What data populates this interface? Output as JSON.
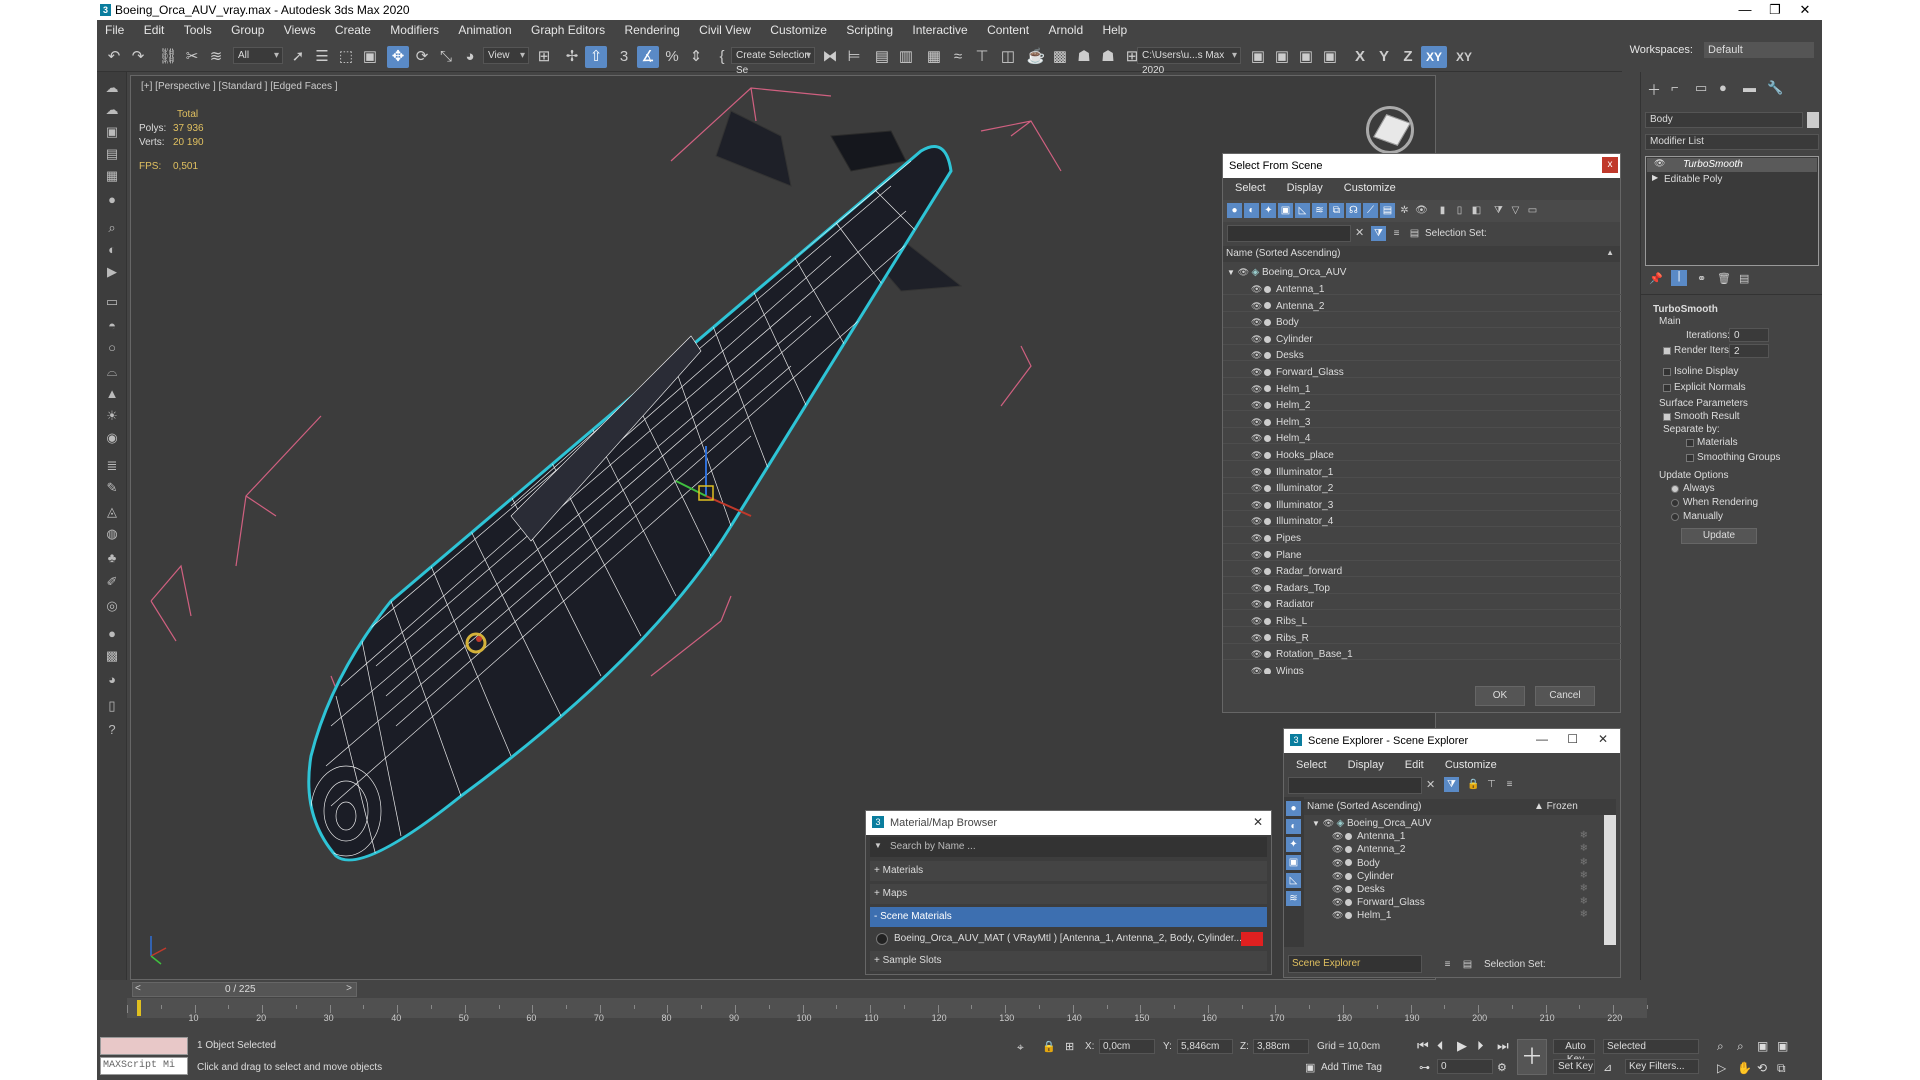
{
  "window": {
    "title": "Boeing_Orca_AUV_vray.max - Autodesk 3ds Max 2020",
    "minimize": "—",
    "maximize": "❐",
    "close": "✕"
  },
  "menu": [
    "File",
    "Edit",
    "Tools",
    "Group",
    "Views",
    "Create",
    "Modifiers",
    "Animation",
    "Graph Editors",
    "Rendering",
    "Civil View",
    "Customize",
    "Scripting",
    "Interactive",
    "Content",
    "Arnold",
    "Help"
  ],
  "workspace": {
    "label": "Workspaces:",
    "value": "Default"
  },
  "toolbar": {
    "filter": "All",
    "view": "View",
    "selection_set": "Create Selection Se",
    "path": "C:\\Users\\u...s Max 2020",
    "axes": [
      "X",
      "Y",
      "Z",
      "XY",
      "XY"
    ]
  },
  "viewport": {
    "label": "[+] [Perspective ] [Standard ] [Edged Faces ]",
    "stats": {
      "total_label": "Total",
      "polys_label": "Polys:",
      "polys": "37 936",
      "verts_label": "Verts:",
      "verts": "20 190",
      "fps_label": "FPS:",
      "fps": "0,501"
    }
  },
  "command_panel": {
    "object_name": "Body",
    "modifier_list": "Modifier List",
    "stack": [
      "TurboSmooth",
      "Editable Poly"
    ],
    "rollout": "TurboSmooth",
    "main": "Main",
    "iterations_label": "Iterations:",
    "iterations": "0",
    "render_iters_label": "Render Iters:",
    "render_iters": "2",
    "isoline": "Isoline Display",
    "explicit_normals": "Explicit Normals",
    "surface_params": "Surface Parameters",
    "smooth_result": "Smooth Result",
    "separate_by": "Separate by:",
    "materials": "Materials",
    "smoothing_groups": "Smoothing Groups",
    "update_options": "Update Options",
    "always": "Always",
    "when_rendering": "When Rendering",
    "manually": "Manually",
    "update_btn": "Update"
  },
  "select_from_scene": {
    "title": "Select From Scene",
    "close": "x",
    "menu": [
      "Select",
      "Display",
      "Customize"
    ],
    "selection_set_label": "Selection Set:",
    "column": "Name (Sorted Ascending)",
    "root": "Boeing_Orca_AUV",
    "items": [
      "Antenna_1",
      "Antenna_2",
      "Body",
      "Cylinder",
      "Desks",
      "Forward_Glass",
      "Helm_1",
      "Helm_2",
      "Helm_3",
      "Helm_4",
      "Hooks_place",
      "Illuminator_1",
      "Illuminator_2",
      "Illuminator_3",
      "Illuminator_4",
      "Pipes",
      "Plane",
      "Radar_forward",
      "Radars_Top",
      "Radiator",
      "Ribs_L",
      "Ribs_R",
      "Rotation_Base_1",
      "Wings"
    ],
    "ok": "OK",
    "cancel": "Cancel"
  },
  "scene_explorer": {
    "title": "Scene Explorer - Scene Explorer",
    "menu": [
      "Select",
      "Display",
      "Edit",
      "Customize"
    ],
    "column": "Name (Sorted Ascending)",
    "frozen": "▲ Frozen",
    "root": "Boeing_Orca_AUV",
    "items": [
      "Antenna_1",
      "Antenna_2",
      "Body",
      "Cylinder",
      "Desks",
      "Forward_Glass",
      "Helm_1"
    ],
    "footer_name": "Scene Explorer",
    "selection_set_label": "Selection Set:"
  },
  "material_browser": {
    "title": "Material/Map Browser",
    "search": "Search by Name ...",
    "groups": [
      "+ Materials",
      "+ Maps",
      "- Scene Materials",
      "+ Sample Slots"
    ],
    "scene_material": "Boeing_Orca_AUV_MAT ( VRayMtl ) [Antenna_1, Antenna_2, Body, Cylinder..."
  },
  "timeline": {
    "frame": "0 / 225",
    "ticks": [
      "10",
      "20",
      "30",
      "40",
      "50",
      "60",
      "70",
      "80",
      "90",
      "100",
      "110",
      "120",
      "130",
      "140",
      "150",
      "160",
      "170",
      "180",
      "190",
      "200",
      "210",
      "220"
    ]
  },
  "status": {
    "maxscript": "MAXScript Mi",
    "selected": "1 Object Selected",
    "hint": "Click and drag to select and move objects",
    "x_label": "X:",
    "x": "0,0cm",
    "y_label": "Y:",
    "y": "5,846cm",
    "z_label": "Z:",
    "z": "3,88cm",
    "grid": "Grid = 10,0cm",
    "add_time_tag": "Add Time Tag",
    "auto_key": "Auto Key",
    "set_key": "Set Key",
    "selected_dd": "Selected",
    "key_filters": "Key Filters...",
    "frame_field": "0"
  },
  "colors": {
    "accent": "#5a8ac6",
    "selection": "#2ec4d6",
    "wire": "#ffffff",
    "hull": "#1b1d26",
    "bbox": "#d06080"
  }
}
